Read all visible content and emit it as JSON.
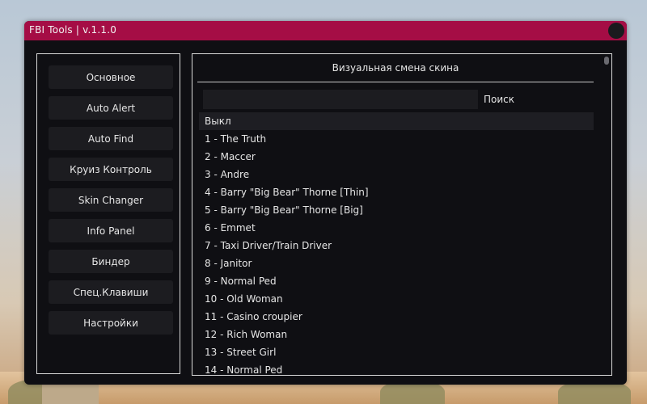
{
  "window": {
    "title": "FBI Tools | v.1.1.0"
  },
  "sidebar": {
    "items": [
      {
        "label": "Основное"
      },
      {
        "label": "Auto Alert"
      },
      {
        "label": "Auto Find"
      },
      {
        "label": "Круиз Контроль"
      },
      {
        "label": "Skin Changer"
      },
      {
        "label": "Info Panel"
      },
      {
        "label": "Биндер"
      },
      {
        "label": "Спец.Клавиши"
      },
      {
        "label": "Настройки"
      }
    ]
  },
  "main": {
    "header": "Визуальная смена скина",
    "search": {
      "value": "",
      "label": "Поиск"
    },
    "skins": [
      {
        "label": "Выкл",
        "selected": true
      },
      {
        "label": "1 - The Truth"
      },
      {
        "label": "2 - Maccer"
      },
      {
        "label": "3 - Andre"
      },
      {
        "label": "4 - Barry \"Big Bear\" Thorne [Thin]"
      },
      {
        "label": "5 - Barry \"Big Bear\" Thorne [Big]"
      },
      {
        "label": "6 - Emmet"
      },
      {
        "label": "7 - Taxi Driver/Train Driver"
      },
      {
        "label": "8 - Janitor"
      },
      {
        "label": "9 - Normal Ped"
      },
      {
        "label": "10 - Old Woman"
      },
      {
        "label": "11 - Casino croupier"
      },
      {
        "label": "12 - Rich Woman"
      },
      {
        "label": "13 - Street Girl"
      },
      {
        "label": "14 - Normal Ped"
      }
    ]
  },
  "colors": {
    "titlebar": "#a50d45",
    "window_bg": "#0f0f13",
    "button_bg": "#1c1c20",
    "text": "#e6e6e6"
  }
}
